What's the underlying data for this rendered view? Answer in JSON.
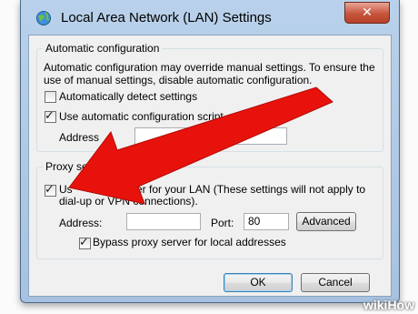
{
  "window": {
    "title": "Local Area Network (LAN) Settings",
    "close_glyph": "✕"
  },
  "auto_config": {
    "group_label": "Automatic configuration",
    "description_line1": "Automatic configuration may override manual settings.  To ensure the",
    "description_line2": "use of manual settings, disable automatic configuration.",
    "detect_settings": {
      "label": "Automatically detect settings",
      "checked": false
    },
    "use_script": {
      "label": "Use automatic configuration script",
      "checked": true
    },
    "address_label": "Address",
    "address_value": ""
  },
  "proxy": {
    "group_label_visible": "Proxy se",
    "use_proxy": {
      "checked": true,
      "label_visible_line1": "Us",
      "label_visible_line1b": "rver for your LAN (These settings will not apply to",
      "label_line2": "dial-up or VPN connections)."
    },
    "address_label": "Address:",
    "address_value": "",
    "port_label": "Port:",
    "port_value": "80",
    "advanced_label": "Advanced",
    "bypass": {
      "label": "Bypass proxy server for local addresses",
      "checked": true
    }
  },
  "buttons": {
    "ok_label": "OK",
    "cancel_label": "Cancel"
  },
  "annotation": {
    "arrow_color": "#e8120c"
  },
  "watermark": {
    "prefix": "wiki",
    "suffix": "How"
  }
}
